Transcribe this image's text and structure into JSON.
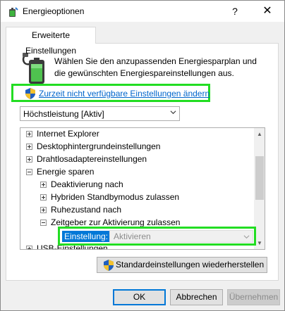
{
  "window": {
    "title": "Energieoptionen",
    "help_label": "?",
    "close_label": "✕"
  },
  "tab": {
    "label": "Erweiterte Einstellungen"
  },
  "intro": {
    "text": "Wählen Sie den anzupassenden Energiesparplan und die gewünschten Energiespareinstellungen aus."
  },
  "link": {
    "text": "Zurzeit nicht verfügbare Einstellungen ändern"
  },
  "plan_select": {
    "value": "Höchstleistung [Aktiv]"
  },
  "tree": {
    "items": [
      {
        "label": "Internet Explorer",
        "expanded": false,
        "level": 0
      },
      {
        "label": "Desktophintergrundeinstellungen",
        "expanded": false,
        "level": 0
      },
      {
        "label": "Drahtlosadaptereinstellungen",
        "expanded": false,
        "level": 0
      },
      {
        "label": "Energie sparen",
        "expanded": true,
        "level": 0
      },
      {
        "label": "Deaktivierung nach",
        "expanded": false,
        "level": 1
      },
      {
        "label": "Hybriden Standbymodus zulassen",
        "expanded": false,
        "level": 1
      },
      {
        "label": "Ruhezustand nach",
        "expanded": false,
        "level": 1
      },
      {
        "label": "Zeitgeber zur Aktivierung zulassen",
        "expanded": true,
        "level": 1
      },
      {
        "label": "USB-Einstellungen",
        "expanded": false,
        "level": 0
      }
    ],
    "setting": {
      "label": "Einstellung:",
      "value": "Aktivieren"
    }
  },
  "buttons": {
    "restore": "Standardeinstellungen wiederherstellen",
    "ok": "OK",
    "cancel": "Abbrechen",
    "apply": "Übernehmen"
  },
  "colors": {
    "highlight": "#22dd22",
    "selection": "#0078d7",
    "link": "#0066cc"
  },
  "icons": {
    "app": "battery-settings-icon",
    "uac": "uac-shield-icon"
  }
}
